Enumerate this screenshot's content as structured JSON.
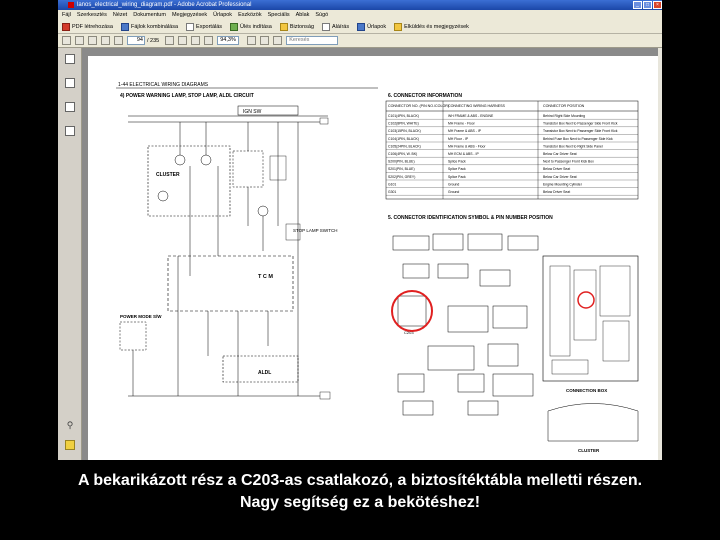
{
  "window": {
    "title": "lanos_electrical_wiring_diagram.pdf - Adobe Acrobat Professional",
    "menu": [
      "Fájl",
      "Szerkesztés",
      "Nézet",
      "Dokumentum",
      "Megjegyzések",
      "Űrlapok",
      "Eszközök",
      "Speciális",
      "Ablak",
      "Súgó"
    ],
    "toolbar": {
      "create_pdf": "PDF létrehozása",
      "combine": "Fájlok kombinálása",
      "export": "Exportálás",
      "start_meeting": "Ülés indítása",
      "secure": "Biztonság",
      "sign": "Aláírás",
      "forms": "Űrlapok",
      "review": "Elküldés és megjegyzések"
    },
    "nav": {
      "page_current": "94",
      "page_total": "/ 235",
      "zoom": "94,3%",
      "search_placeholder": "Keresés"
    }
  },
  "diagram": {
    "header": "1-44  ELECTRICAL WIRING DIAGRAMS",
    "section_title": "4)  POWER WARNING LAMP, STOP LAMP, ALDL CIRCUIT",
    "connector_info_title": "6.  CONNECTOR INFORMATION",
    "connector_id_title": "5.  CONNECTOR IDENTIFICATION SYMBOL & PIN NUMBER POSITION",
    "table_headers": [
      "CONNECTOR NO. (PIN NO./COLOR)",
      "CONNECTING WIRING HARNESS",
      "CONNECTOR POSITION"
    ],
    "table_rows": [
      [
        "C101(4PIN, BLACK)",
        "WH FRAME & ABS - ENGINE",
        "Behind Right Side Mounting"
      ],
      [
        "C102(8PIN, WHITE)",
        "MH Frame - Floor",
        "Transistor Box Next to Passenger Side Front Kick"
      ],
      [
        "C103(15PIN, BLACK)",
        "MH Frame & ABS - IP",
        "Transistor Box Next to Passenger Side Front Kick"
      ],
      [
        "C104(1PIN, BLACK)",
        "MH Floor - IP",
        "Behind Fuse Box Next to Passenger Side Kick"
      ],
      [
        "C105(24PIN, BLACK)",
        "MH Frame & ABS - Floor",
        "Transistor Box Next to Right Side Panel"
      ],
      [
        "C106(4PIN, W. BK)",
        "MH ECM & ABS - IP",
        "Below Car Driver Seat"
      ],
      [
        "S200(PIN, BLUE)",
        "Splice Pack",
        "Next to Passenger Front Kick Box"
      ],
      [
        "S201(PIN, BLUE)",
        "Splice Pack",
        "Below Driver Seat"
      ],
      [
        "S202(PIN, GREY)",
        "Splice Pack",
        "Below Car Driver Seat"
      ],
      [
        "G101",
        "Ground",
        "Engine Mounting Cylinder"
      ],
      [
        "G301",
        "Ground",
        "Below Driver Seat"
      ]
    ],
    "labels": {
      "ign_sw": "IGN SW",
      "cluster": "CLUSTER",
      "stop_lamp_switch": "STOP LAMP SWITCH",
      "tcm": "T C M",
      "power_mode_sw": "POWER MODE S/W",
      "aldl": "ALDL",
      "cluster_conn": "CLUSTER",
      "connection_box": "CONNECTION BOX",
      "c203": "C203"
    }
  },
  "caption": {
    "line1": "A bekarikázott rész a C203-as csatlakozó, a biztosítéktábla melletti részen.",
    "line2": "Nagy segítség ez a bekötéshez!"
  }
}
